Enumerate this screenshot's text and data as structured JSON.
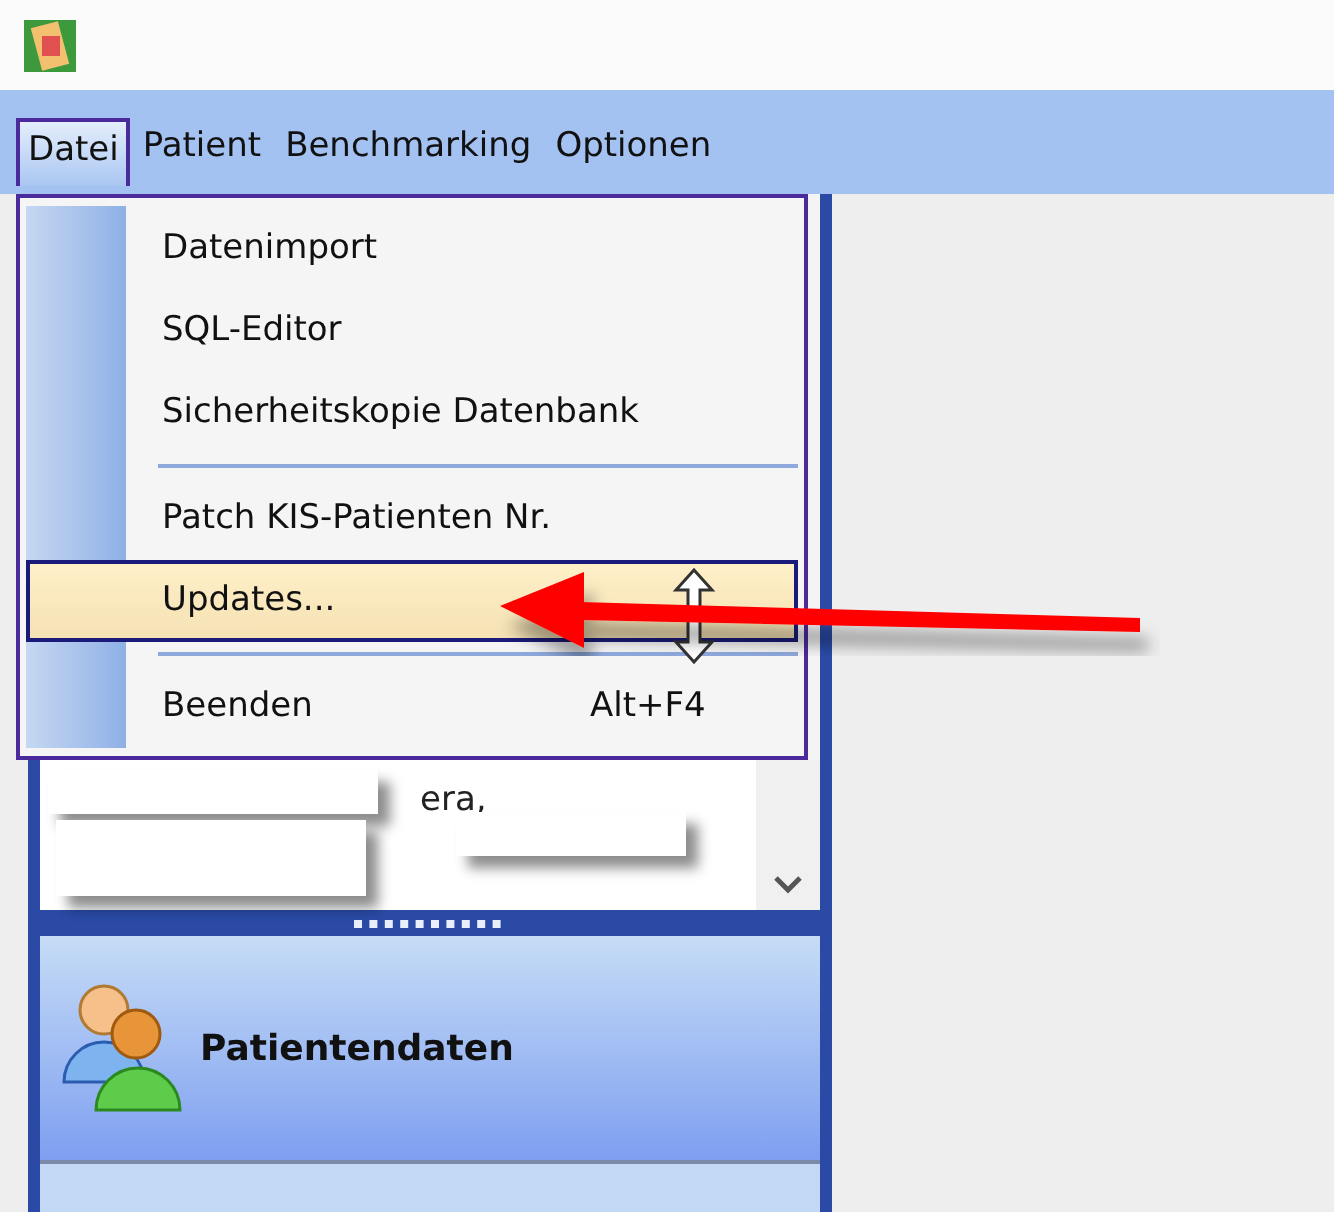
{
  "menu_bar": [
    {
      "label": "Datei",
      "selected": true
    },
    {
      "label": "Patient",
      "selected": false
    },
    {
      "label": "Benchmarking",
      "selected": false
    },
    {
      "label": "Optionen",
      "selected": false
    }
  ],
  "menu": {
    "items": [
      {
        "kind": "item",
        "label": "Datenimport",
        "selected": false
      },
      {
        "kind": "item",
        "label": "SQL-Editor",
        "selected": false
      },
      {
        "kind": "item",
        "label": "Sicherheitskopie Datenbank",
        "selected": false
      },
      {
        "kind": "separator"
      },
      {
        "kind": "item",
        "label": "Patch KIS-Patienten Nr.",
        "selected": false
      },
      {
        "kind": "item",
        "label": "Updates...",
        "selected": true
      },
      {
        "kind": "separator"
      },
      {
        "kind": "item",
        "label": "Beenden",
        "shortcut": "Alt+F4",
        "selected": false
      }
    ]
  },
  "patient_list": {
    "text": "era,"
  },
  "nav": [
    {
      "label": "Patientendaten"
    }
  ]
}
